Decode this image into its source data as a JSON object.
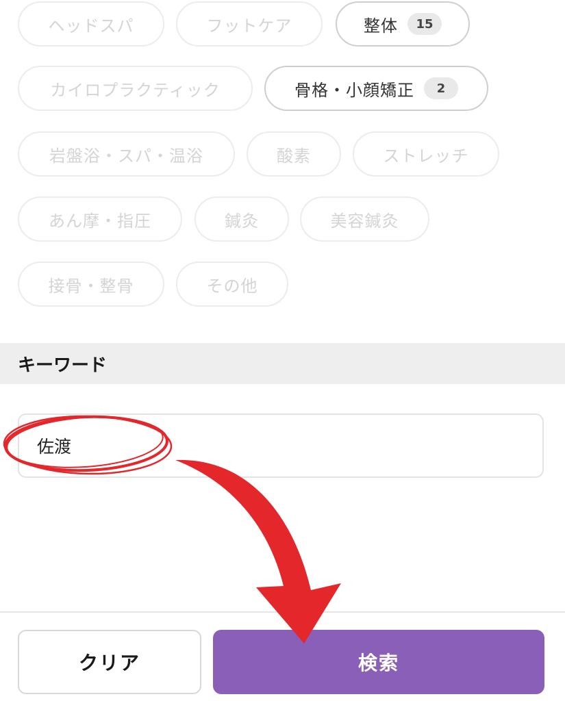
{
  "categories": [
    {
      "label": "ヘッドスパ",
      "selected": false
    },
    {
      "label": "フットケア",
      "selected": false
    },
    {
      "label": "整体",
      "selected": true,
      "count": "15"
    },
    {
      "label": "カイロプラクティック",
      "selected": false
    },
    {
      "label": "骨格・小顔矯正",
      "selected": true,
      "count": "2"
    },
    {
      "label": "岩盤浴・スパ・温浴",
      "selected": false
    },
    {
      "label": "酸素",
      "selected": false
    },
    {
      "label": "ストレッチ",
      "selected": false
    },
    {
      "label": "あん摩・指圧",
      "selected": false
    },
    {
      "label": "鍼灸",
      "selected": false
    },
    {
      "label": "美容鍼灸",
      "selected": false
    },
    {
      "label": "接骨・整骨",
      "selected": false
    },
    {
      "label": "その他",
      "selected": false
    }
  ],
  "keyword": {
    "heading": "キーワード",
    "value": "佐渡"
  },
  "footer": {
    "clear_label": "クリア",
    "search_label": "検索"
  },
  "colors": {
    "accent": "#8a5fb8",
    "annotation": "#e3272b"
  }
}
